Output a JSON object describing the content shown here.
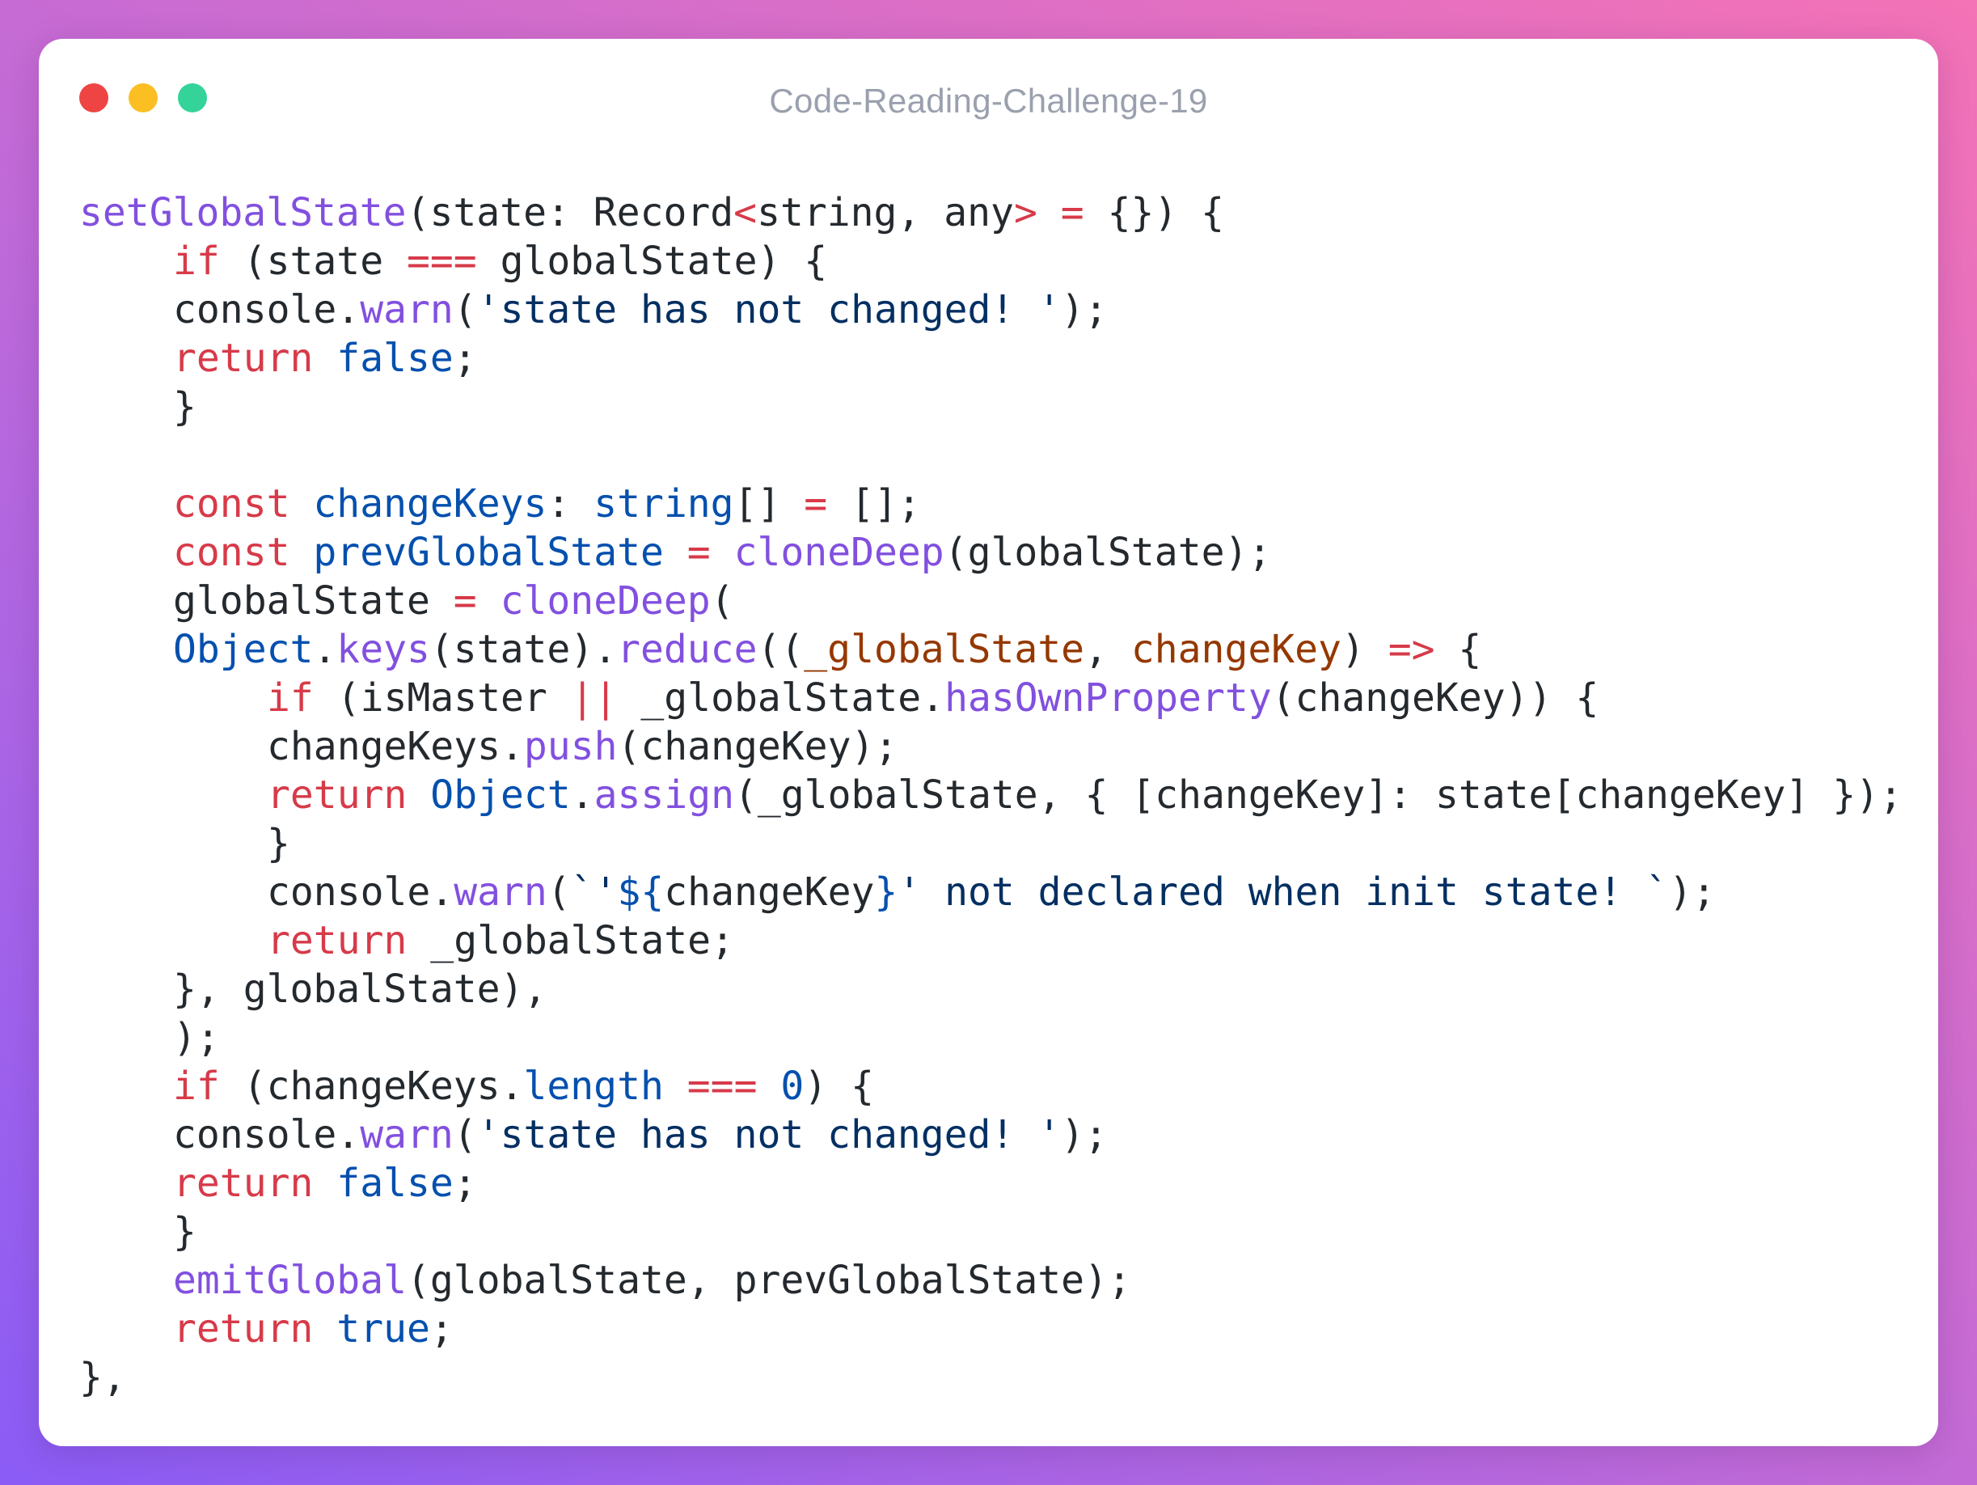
{
  "window": {
    "title": "Code-Reading-Challenge-19",
    "controls": {
      "close_color": "#ef4444",
      "minimize_color": "#fbbf24",
      "zoom_color": "#34d399"
    }
  },
  "colors": {
    "plain": "#24292e",
    "keyword": "#d73a49",
    "function": "#8250df",
    "identifier": "#0550ae",
    "string": "#032f62",
    "parameter": "#953800",
    "comment": "#9aa0ad"
  },
  "code": {
    "language": "typescript",
    "lines": [
      {
        "indent": 0,
        "tokens": [
          {
            "text": "setGlobalState",
            "kind": "function"
          },
          {
            "text": "(state: Record",
            "kind": "plain"
          },
          {
            "text": "<",
            "kind": "keyword"
          },
          {
            "text": "string, any",
            "kind": "plain"
          },
          {
            "text": ">",
            "kind": "keyword"
          },
          {
            "text": " ",
            "kind": "plain"
          },
          {
            "text": "=",
            "kind": "keyword"
          },
          {
            "text": " {}) {",
            "kind": "plain"
          }
        ]
      },
      {
        "indent": 1,
        "tokens": [
          {
            "text": "if",
            "kind": "keyword"
          },
          {
            "text": " (state ",
            "kind": "plain"
          },
          {
            "text": "===",
            "kind": "keyword"
          },
          {
            "text": " globalState) {",
            "kind": "plain"
          }
        ]
      },
      {
        "indent": 1,
        "tokens": [
          {
            "text": "console.",
            "kind": "plain"
          },
          {
            "text": "warn",
            "kind": "function"
          },
          {
            "text": "(",
            "kind": "plain"
          },
          {
            "text": "'state has not changed! '",
            "kind": "string"
          },
          {
            "text": ");",
            "kind": "plain"
          }
        ]
      },
      {
        "indent": 1,
        "tokens": [
          {
            "text": "return",
            "kind": "keyword"
          },
          {
            "text": " ",
            "kind": "plain"
          },
          {
            "text": "false",
            "kind": "identifier"
          },
          {
            "text": ";",
            "kind": "plain"
          }
        ]
      },
      {
        "indent": 1,
        "tokens": [
          {
            "text": "}",
            "kind": "plain"
          }
        ]
      },
      {
        "indent": 0,
        "tokens": []
      },
      {
        "indent": 1,
        "tokens": [
          {
            "text": "const",
            "kind": "keyword"
          },
          {
            "text": " ",
            "kind": "plain"
          },
          {
            "text": "changeKeys",
            "kind": "identifier"
          },
          {
            "text": ": ",
            "kind": "plain"
          },
          {
            "text": "string",
            "kind": "identifier"
          },
          {
            "text": "[] ",
            "kind": "plain"
          },
          {
            "text": "=",
            "kind": "keyword"
          },
          {
            "text": " [];",
            "kind": "plain"
          }
        ]
      },
      {
        "indent": 1,
        "tokens": [
          {
            "text": "const",
            "kind": "keyword"
          },
          {
            "text": " ",
            "kind": "plain"
          },
          {
            "text": "prevGlobalState",
            "kind": "identifier"
          },
          {
            "text": " ",
            "kind": "plain"
          },
          {
            "text": "=",
            "kind": "keyword"
          },
          {
            "text": " ",
            "kind": "plain"
          },
          {
            "text": "cloneDeep",
            "kind": "function"
          },
          {
            "text": "(globalState);",
            "kind": "plain"
          }
        ]
      },
      {
        "indent": 1,
        "tokens": [
          {
            "text": "globalState ",
            "kind": "plain"
          },
          {
            "text": "=",
            "kind": "keyword"
          },
          {
            "text": " ",
            "kind": "plain"
          },
          {
            "text": "cloneDeep",
            "kind": "function"
          },
          {
            "text": "(",
            "kind": "plain"
          }
        ]
      },
      {
        "indent": 1,
        "tokens": [
          {
            "text": "Object",
            "kind": "identifier"
          },
          {
            "text": ".",
            "kind": "plain"
          },
          {
            "text": "keys",
            "kind": "function"
          },
          {
            "text": "(state).",
            "kind": "plain"
          },
          {
            "text": "reduce",
            "kind": "function"
          },
          {
            "text": "((",
            "kind": "plain"
          },
          {
            "text": "_globalState",
            "kind": "parameter"
          },
          {
            "text": ", ",
            "kind": "plain"
          },
          {
            "text": "changeKey",
            "kind": "parameter"
          },
          {
            "text": ") ",
            "kind": "plain"
          },
          {
            "text": "=>",
            "kind": "keyword"
          },
          {
            "text": " {",
            "kind": "plain"
          }
        ]
      },
      {
        "indent": 2,
        "tokens": [
          {
            "text": "if",
            "kind": "keyword"
          },
          {
            "text": " (isMaster ",
            "kind": "plain"
          },
          {
            "text": "||",
            "kind": "keyword"
          },
          {
            "text": " _globalState.",
            "kind": "plain"
          },
          {
            "text": "hasOwnProperty",
            "kind": "function"
          },
          {
            "text": "(changeKey)) {",
            "kind": "plain"
          }
        ]
      },
      {
        "indent": 2,
        "tokens": [
          {
            "text": "changeKeys.",
            "kind": "plain"
          },
          {
            "text": "push",
            "kind": "function"
          },
          {
            "text": "(changeKey);",
            "kind": "plain"
          }
        ]
      },
      {
        "indent": 2,
        "tokens": [
          {
            "text": "return",
            "kind": "keyword"
          },
          {
            "text": " ",
            "kind": "plain"
          },
          {
            "text": "Object",
            "kind": "identifier"
          },
          {
            "text": ".",
            "kind": "plain"
          },
          {
            "text": "assign",
            "kind": "function"
          },
          {
            "text": "(_globalState, { [changeKey]: state[changeKey] });",
            "kind": "plain"
          }
        ]
      },
      {
        "indent": 2,
        "tokens": [
          {
            "text": "}",
            "kind": "plain"
          }
        ]
      },
      {
        "indent": 2,
        "tokens": [
          {
            "text": "console.",
            "kind": "plain"
          },
          {
            "text": "warn",
            "kind": "function"
          },
          {
            "text": "(",
            "kind": "plain"
          },
          {
            "text": "`'",
            "kind": "string"
          },
          {
            "text": "${",
            "kind": "identifier"
          },
          {
            "text": "changeKey",
            "kind": "plain"
          },
          {
            "text": "}",
            "kind": "identifier"
          },
          {
            "text": "' not declared when init state! `",
            "kind": "string"
          },
          {
            "text": ");",
            "kind": "plain"
          }
        ]
      },
      {
        "indent": 2,
        "tokens": [
          {
            "text": "return",
            "kind": "keyword"
          },
          {
            "text": " _globalState;",
            "kind": "plain"
          }
        ]
      },
      {
        "indent": 1,
        "tokens": [
          {
            "text": "}, globalState),",
            "kind": "plain"
          }
        ]
      },
      {
        "indent": 1,
        "tokens": [
          {
            "text": ");",
            "kind": "plain"
          }
        ]
      },
      {
        "indent": 1,
        "tokens": [
          {
            "text": "if",
            "kind": "keyword"
          },
          {
            "text": " (changeKeys.",
            "kind": "plain"
          },
          {
            "text": "length",
            "kind": "identifier"
          },
          {
            "text": " ",
            "kind": "plain"
          },
          {
            "text": "===",
            "kind": "keyword"
          },
          {
            "text": " ",
            "kind": "plain"
          },
          {
            "text": "0",
            "kind": "identifier"
          },
          {
            "text": ") {",
            "kind": "plain"
          }
        ]
      },
      {
        "indent": 1,
        "tokens": [
          {
            "text": "console.",
            "kind": "plain"
          },
          {
            "text": "warn",
            "kind": "function"
          },
          {
            "text": "(",
            "kind": "plain"
          },
          {
            "text": "'state has not changed! '",
            "kind": "string"
          },
          {
            "text": ");",
            "kind": "plain"
          }
        ]
      },
      {
        "indent": 1,
        "tokens": [
          {
            "text": "return",
            "kind": "keyword"
          },
          {
            "text": " ",
            "kind": "plain"
          },
          {
            "text": "false",
            "kind": "identifier"
          },
          {
            "text": ";",
            "kind": "plain"
          }
        ]
      },
      {
        "indent": 1,
        "tokens": [
          {
            "text": "}",
            "kind": "plain"
          }
        ]
      },
      {
        "indent": 1,
        "tokens": [
          {
            "text": "emitGlobal",
            "kind": "function"
          },
          {
            "text": "(globalState, prevGlobalState);",
            "kind": "plain"
          }
        ]
      },
      {
        "indent": 1,
        "tokens": [
          {
            "text": "return",
            "kind": "keyword"
          },
          {
            "text": " ",
            "kind": "plain"
          },
          {
            "text": "true",
            "kind": "identifier"
          },
          {
            "text": ";",
            "kind": "plain"
          }
        ]
      },
      {
        "indent": 0,
        "tokens": [
          {
            "text": "},",
            "kind": "plain"
          }
        ]
      }
    ]
  }
}
